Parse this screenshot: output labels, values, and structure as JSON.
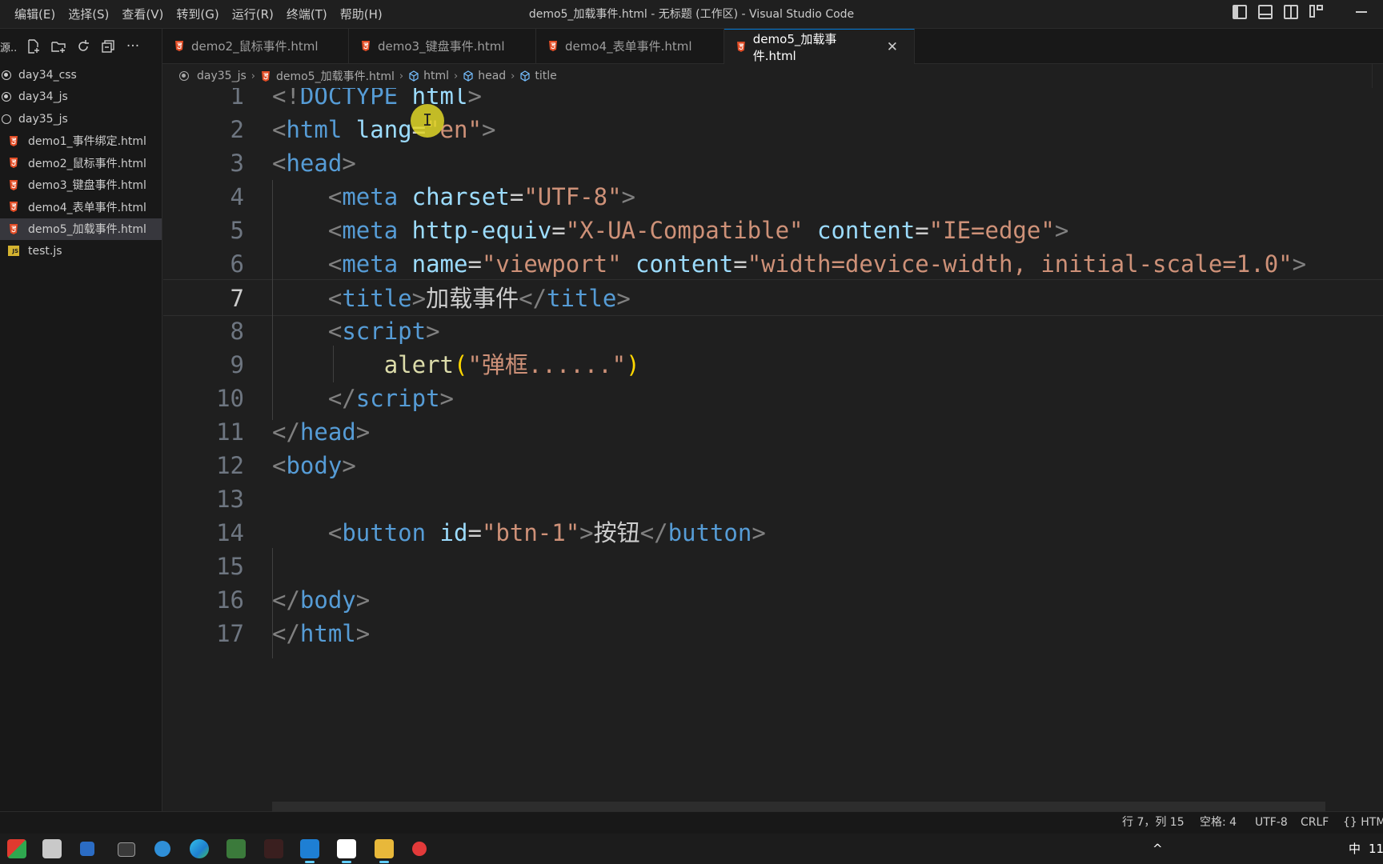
{
  "menu": [
    "编辑(E)",
    "选择(S)",
    "查看(V)",
    "转到(G)",
    "运行(R)",
    "终端(T)",
    "帮助(H)"
  ],
  "window_title": "demo5_加载事件.html - 无标题 (工作区) - Visual Studio Code",
  "sidebar": {
    "title": "源...",
    "items": [
      {
        "label": "day34_css",
        "kind": "folder",
        "dot": true
      },
      {
        "label": "day34_js",
        "kind": "folder",
        "dot": true
      },
      {
        "label": "day35_js",
        "kind": "folder",
        "dot": false
      },
      {
        "label": "demo1_事件绑定.html",
        "kind": "html"
      },
      {
        "label": "demo2_鼠标事件.html",
        "kind": "html"
      },
      {
        "label": "demo3_键盘事件.html",
        "kind": "html"
      },
      {
        "label": "demo4_表单事件.html",
        "kind": "html"
      },
      {
        "label": "demo5_加载事件.html",
        "kind": "html",
        "active": true
      },
      {
        "label": "test.js",
        "kind": "js"
      }
    ]
  },
  "tabs": [
    {
      "label": "demo2_鼠标事件.html"
    },
    {
      "label": "demo3_键盘事件.html"
    },
    {
      "label": "demo4_表单事件.html"
    },
    {
      "label": "demo5_加载事件.html",
      "active": true
    }
  ],
  "tab_close": "✕",
  "breadcrumb": [
    "day35_js",
    "demo5_加载事件.html",
    "html",
    "head",
    "title"
  ],
  "code": {
    "current_line": 7,
    "lines": [
      {
        "n": "1",
        "t": [
          [
            "p",
            "<!"
          ],
          [
            "t",
            "DOCTYPE"
          ],
          [
            "x",
            " "
          ],
          [
            "a",
            "html"
          ],
          [
            "p",
            ">"
          ]
        ]
      },
      {
        "n": "2",
        "t": [
          [
            "p",
            "<"
          ],
          [
            "t",
            "html"
          ],
          [
            "x",
            " "
          ],
          [
            "a",
            "lang"
          ],
          [
            "x",
            "="
          ],
          [
            "s",
            "\"en\""
          ],
          [
            "p",
            ">"
          ]
        ]
      },
      {
        "n": "3",
        "t": [
          [
            "p",
            "<"
          ],
          [
            "t",
            "head"
          ],
          [
            "p",
            ">"
          ]
        ]
      },
      {
        "n": "4",
        "t": [
          [
            "x",
            "    "
          ],
          [
            "p",
            "<"
          ],
          [
            "t",
            "meta"
          ],
          [
            "x",
            " "
          ],
          [
            "a",
            "charset"
          ],
          [
            "x",
            "="
          ],
          [
            "s",
            "\"UTF-8\""
          ],
          [
            "p",
            ">"
          ]
        ]
      },
      {
        "n": "5",
        "t": [
          [
            "x",
            "    "
          ],
          [
            "p",
            "<"
          ],
          [
            "t",
            "meta"
          ],
          [
            "x",
            " "
          ],
          [
            "a",
            "http-equiv"
          ],
          [
            "x",
            "="
          ],
          [
            "s",
            "\"X-UA-Compatible\""
          ],
          [
            "x",
            " "
          ],
          [
            "a",
            "content"
          ],
          [
            "x",
            "="
          ],
          [
            "s",
            "\"IE=edge\""
          ],
          [
            "p",
            ">"
          ]
        ]
      },
      {
        "n": "6",
        "t": [
          [
            "x",
            "    "
          ],
          [
            "p",
            "<"
          ],
          [
            "t",
            "meta"
          ],
          [
            "x",
            " "
          ],
          [
            "a",
            "name"
          ],
          [
            "x",
            "="
          ],
          [
            "s",
            "\"viewport\""
          ],
          [
            "x",
            " "
          ],
          [
            "a",
            "content"
          ],
          [
            "x",
            "="
          ],
          [
            "s",
            "\"width=device-width, initial-scale=1.0\""
          ],
          [
            "p",
            ">"
          ]
        ]
      },
      {
        "n": "7",
        "t": [
          [
            "x",
            "    "
          ],
          [
            "p",
            "<"
          ],
          [
            "t",
            "title"
          ],
          [
            "p",
            ">"
          ],
          [
            "x",
            "加载事件"
          ],
          [
            "p",
            "</"
          ],
          [
            "t",
            "title"
          ],
          [
            "p",
            ">"
          ]
        ]
      },
      {
        "n": "8",
        "t": [
          [
            "x",
            "    "
          ],
          [
            "p",
            "<"
          ],
          [
            "t",
            "script"
          ],
          [
            "p",
            ">"
          ]
        ]
      },
      {
        "n": "9",
        "t": [
          [
            "x",
            "        "
          ],
          [
            "f",
            "alert"
          ],
          [
            "b",
            "("
          ],
          [
            "s",
            "\"弹框......\""
          ],
          [
            "b",
            ")"
          ]
        ]
      },
      {
        "n": "10",
        "t": [
          [
            "x",
            "    "
          ],
          [
            "p",
            "</"
          ],
          [
            "t",
            "script"
          ],
          [
            "p",
            ">"
          ]
        ]
      },
      {
        "n": "11",
        "t": [
          [
            "p",
            "</"
          ],
          [
            "t",
            "head"
          ],
          [
            "p",
            ">"
          ]
        ]
      },
      {
        "n": "12",
        "t": [
          [
            "p",
            "<"
          ],
          [
            "t",
            "body"
          ],
          [
            "p",
            ">"
          ]
        ]
      },
      {
        "n": "13",
        "t": []
      },
      {
        "n": "14",
        "t": [
          [
            "x",
            "    "
          ],
          [
            "p",
            "<"
          ],
          [
            "t",
            "button"
          ],
          [
            "x",
            " "
          ],
          [
            "a",
            "id"
          ],
          [
            "x",
            "="
          ],
          [
            "s",
            "\"btn-1\""
          ],
          [
            "p",
            ">"
          ],
          [
            "x",
            "按钮"
          ],
          [
            "p",
            "</"
          ],
          [
            "t",
            "button"
          ],
          [
            "p",
            ">"
          ]
        ]
      },
      {
        "n": "15",
        "t": []
      },
      {
        "n": "16",
        "t": [
          [
            "p",
            "</"
          ],
          [
            "t",
            "body"
          ],
          [
            "p",
            ">"
          ]
        ]
      },
      {
        "n": "17",
        "t": [
          [
            "p",
            "</"
          ],
          [
            "t",
            "html"
          ],
          [
            "p",
            ">"
          ]
        ]
      }
    ]
  },
  "status": {
    "position": "行 7，列 15",
    "spaces": "空格: 4",
    "encoding": "UTF-8",
    "eol": "CRLF",
    "language": "{} HTM"
  },
  "taskbar": {
    "ime": "中",
    "clock": "11"
  },
  "colors": {
    "accent": "#0078d4",
    "html_icon": "#e44d26",
    "js_icon": "#d4b330",
    "cursor_highlight": "#e1d728"
  }
}
